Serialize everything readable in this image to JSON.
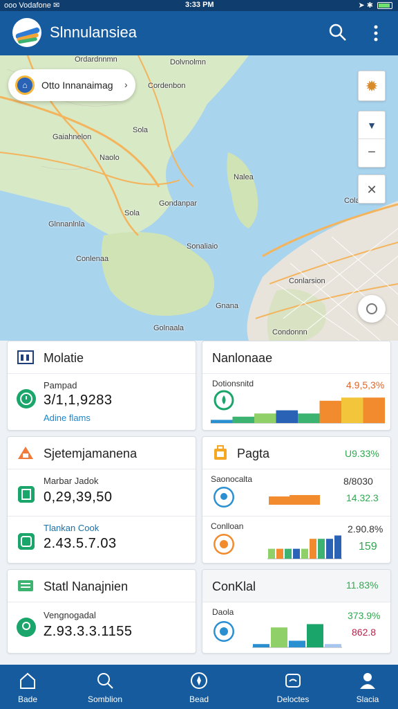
{
  "status": {
    "carrier": "ooo Vodafone ✉",
    "time": "3:33 PM"
  },
  "app": {
    "title": "Slnnulansiea"
  },
  "map": {
    "search_pill": "Otto Innanaimag",
    "labels": [
      "Ordardnnmn",
      "Cordenbon",
      "Gaiahnelon",
      "Naolo",
      "Sola",
      "Nalea",
      "Glnnanlnla",
      "Sola",
      "Conlenaa",
      "Sonaliaio",
      "Gnana",
      "Golnaala",
      "Conlarsion",
      "Condonnn",
      "Gondanpar",
      "Cola",
      "Dolvnolmn"
    ]
  },
  "cards": {
    "c1": {
      "title": "Molatie",
      "sub": "Pampad",
      "value": "3/1,1,9283",
      "link": "Adine flams"
    },
    "c2": {
      "title": "Nanlonaae",
      "sub": "Dotionsnitd",
      "pct": "4.9,5,3%"
    },
    "c3": {
      "title": "Sjetemjamanena",
      "sub1": "Marbar Jadok",
      "value1": "0,29,39,50",
      "sub2": "Tlankan Cook",
      "value2": "2.43.5.7.03"
    },
    "c4": {
      "title": "Pagta",
      "pct": "U9.33%",
      "sub1": "Saonocalta",
      "v1a": "8/8030",
      "v1b": "14.32.3",
      "sub2": "Conlloan",
      "v2a": "2.90.8%",
      "v2b": "159"
    },
    "c5": {
      "title": "Statl Nanajnien",
      "sub": "Vengnogadal",
      "value": "Z.93.3.3.1155"
    },
    "c6": {
      "title": "ConKlal",
      "pct": "11.83%",
      "sub": "Daola",
      "v1": "373.9%",
      "v2": "862.8"
    }
  },
  "nav": {
    "items": [
      "Bade",
      "Somblion",
      "Bead",
      "Deloctes",
      "Slacia"
    ]
  },
  "colors": {
    "primary": "#155b9e",
    "accent_green": "#2fa84f",
    "accent_orange": "#f28b2d",
    "link": "#1a86c8"
  },
  "chart_data": [
    {
      "type": "bar",
      "title": "Nanlonaae",
      "values": [
        1,
        2,
        3,
        4,
        3,
        7,
        8,
        8
      ],
      "ylim": [
        0,
        10
      ]
    },
    {
      "type": "bar",
      "title": "Pagta",
      "values": [
        3,
        3,
        3,
        3,
        3,
        6,
        6,
        6,
        7
      ],
      "ylim": [
        0,
        10
      ]
    },
    {
      "type": "bar",
      "title": "ConKlal",
      "values": [
        1,
        6,
        2,
        7,
        1
      ],
      "ylim": [
        0,
        10
      ]
    }
  ]
}
